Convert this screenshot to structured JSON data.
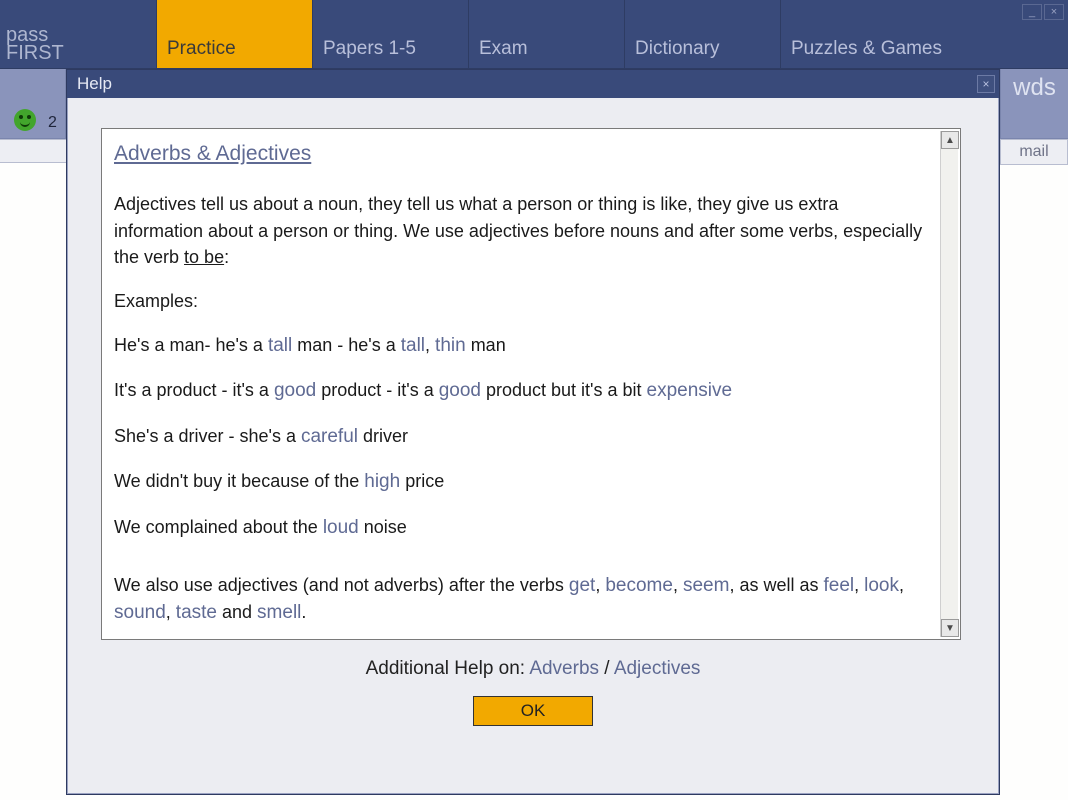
{
  "brand": {
    "line1": "pass",
    "line2": "FIRST"
  },
  "tabs": {
    "items": [
      {
        "label": "Practice",
        "active": true
      },
      {
        "label": "Papers 1-5",
        "active": false
      },
      {
        "label": "Exam",
        "active": false
      },
      {
        "label": "Dictionary",
        "active": false
      },
      {
        "label": "Puzzles & Games",
        "active": false
      }
    ]
  },
  "side": {
    "count": "2",
    "right_label": "wds",
    "mail_label": "mail"
  },
  "dialog": {
    "title": "Help",
    "ok_label": "OK",
    "additional_prefix": "Additional Help on: ",
    "additional_links": {
      "a": "Adverbs",
      "sep": " / ",
      "b": "Adjectives"
    },
    "heading": "Adverbs & Adjectives",
    "intro_1": "Adjectives tell us about a noun, they tell us what a person or thing is like, they give us extra information about a person or thing. We use adjectives before nouns and after some verbs, especially the verb ",
    "intro_tobe": "to be",
    "intro_colon": ":",
    "examples_label": "Examples:",
    "ex1": {
      "a": "He's a man-  he's a ",
      "adj1": "tall",
      "b": " man  -  he's a ",
      "adj2": "tall",
      "c": ", ",
      "adj3": "thin",
      "d": " man"
    },
    "ex2": {
      "a": "It's a product -  it's a ",
      "adj1": "good",
      "b": " product  - it's a ",
      "adj2": "good",
      "c": " product but it's a bit ",
      "adj3": "expensive"
    },
    "ex3": {
      "a": "She's a driver -  she's a ",
      "adj1": "careful",
      "b": " driver"
    },
    "ex4": {
      "a": "We didn't buy it because of the ",
      "adj1": "high",
      "b": " price"
    },
    "ex5": {
      "a": "We complained about the ",
      "adj1": "loud",
      "b": " noise"
    },
    "closing": {
      "a": "We also use adjectives (and not adverbs) after the verbs ",
      "v1": "get",
      "c1": ", ",
      "v2": "become",
      "c2": ", ",
      "v3": "seem",
      "c3": ", as well as ",
      "v4": "feel",
      "c4": ", ",
      "v5": "look",
      "c5": ", ",
      "v6": "sound",
      "c6": ", ",
      "v7": "taste",
      "c7": " and ",
      "v8": "smell",
      "period": "."
    }
  }
}
